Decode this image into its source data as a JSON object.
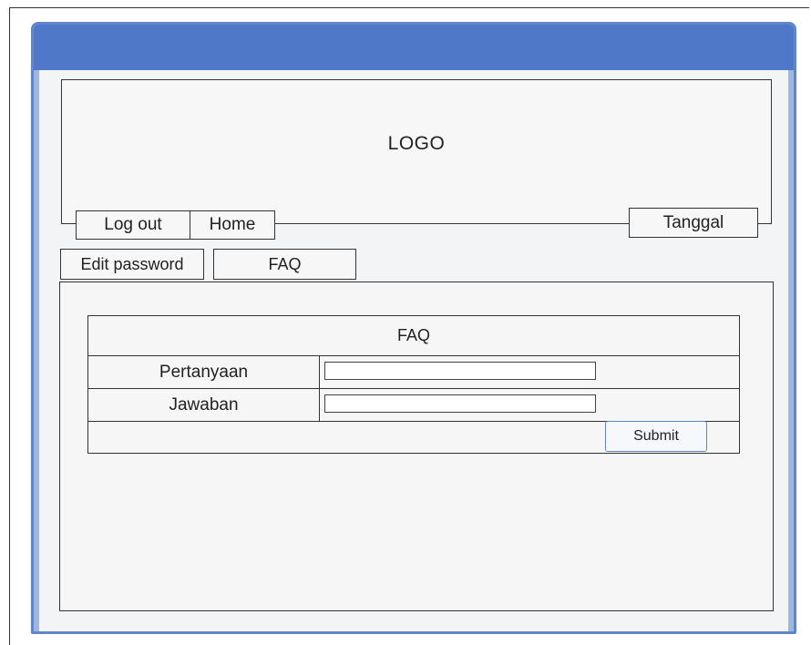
{
  "header": {
    "logo_text": "LOGO"
  },
  "nav": {
    "logout_label": "Log out",
    "home_label": "Home",
    "date_label": "Tanggal",
    "edit_password_label": "Edit password",
    "faq_label": "FAQ"
  },
  "form": {
    "title": "FAQ",
    "question_label": "Pertanyaan",
    "question_value": "",
    "answer_label": "Jawaban",
    "answer_value": "",
    "submit_label": "Submit"
  },
  "colors": {
    "titlebar": "#4f79c8",
    "window_border": "#5f86c9",
    "background": "#f3f4f6"
  }
}
